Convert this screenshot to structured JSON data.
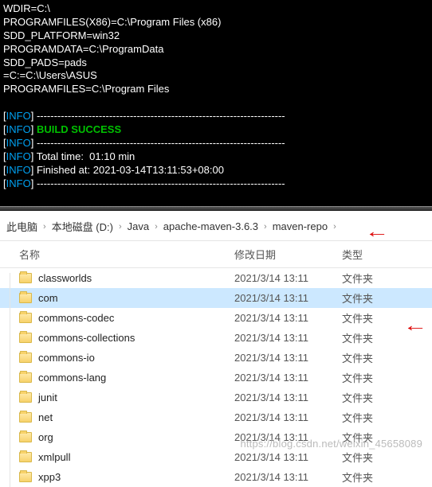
{
  "terminal": {
    "env_lines": [
      "WDIR=C:\\",
      "PROGRAMFILES(X86)=C:\\Program Files (x86)",
      "SDD_PLATFORM=win32",
      "PROGRAMDATA=C:\\ProgramData",
      "SDD_PADS=pads",
      "=C:=C:\\Users\\ASUS",
      "PROGRAMFILES=C:\\Program Files"
    ],
    "info_tag": "INFO",
    "dash_rule": "------------------------------------------------------------------------",
    "build_success": "BUILD SUCCESS",
    "total_time": "Total time:  01:10 min",
    "finished_at": "Finished at: 2021-03-14T13:11:53+08:00"
  },
  "breadcrumb": {
    "segments": [
      "此电脑",
      "本地磁盘 (D:)",
      "Java",
      "apache-maven-3.6.3",
      "maven-repo"
    ]
  },
  "columns": {
    "name": "名称",
    "date": "修改日期",
    "type": "类型"
  },
  "folder_type": "文件夹",
  "rows": [
    {
      "name": "classworlds",
      "date": "2021/3/14 13:11",
      "sel": false
    },
    {
      "name": "com",
      "date": "2021/3/14 13:11",
      "sel": true
    },
    {
      "name": "commons-codec",
      "date": "2021/3/14 13:11",
      "sel": false
    },
    {
      "name": "commons-collections",
      "date": "2021/3/14 13:11",
      "sel": false
    },
    {
      "name": "commons-io",
      "date": "2021/3/14 13:11",
      "sel": false
    },
    {
      "name": "commons-lang",
      "date": "2021/3/14 13:11",
      "sel": false
    },
    {
      "name": "junit",
      "date": "2021/3/14 13:11",
      "sel": false
    },
    {
      "name": "net",
      "date": "2021/3/14 13:11",
      "sel": false
    },
    {
      "name": "org",
      "date": "2021/3/14 13:11",
      "sel": false
    },
    {
      "name": "xmlpull",
      "date": "2021/3/14 13:11",
      "sel": false
    },
    {
      "name": "xpp3",
      "date": "2021/3/14 13:11",
      "sel": false
    }
  ],
  "watermark": "https://blog.csdn.net/weixin_45658089"
}
